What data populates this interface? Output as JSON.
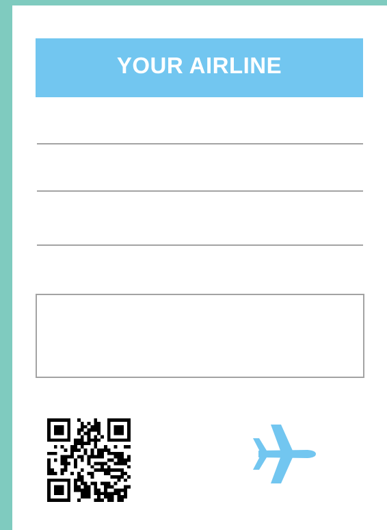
{
  "ticket": {
    "airline_name": "YOUR AIRLINE",
    "fields": [
      {
        "value": ""
      },
      {
        "value": ""
      },
      {
        "value": ""
      }
    ],
    "notes_box": {
      "value": ""
    },
    "icons": {
      "qr": "qr-code-icon",
      "plane": "airplane-icon"
    }
  },
  "colors": {
    "background": "#7fcbbf",
    "card": "#ffffff",
    "header": "#72c6f0",
    "header_text": "#ffffff",
    "line": "#a3a3a3",
    "plane": "#72c6f0",
    "qr": "#000000"
  }
}
